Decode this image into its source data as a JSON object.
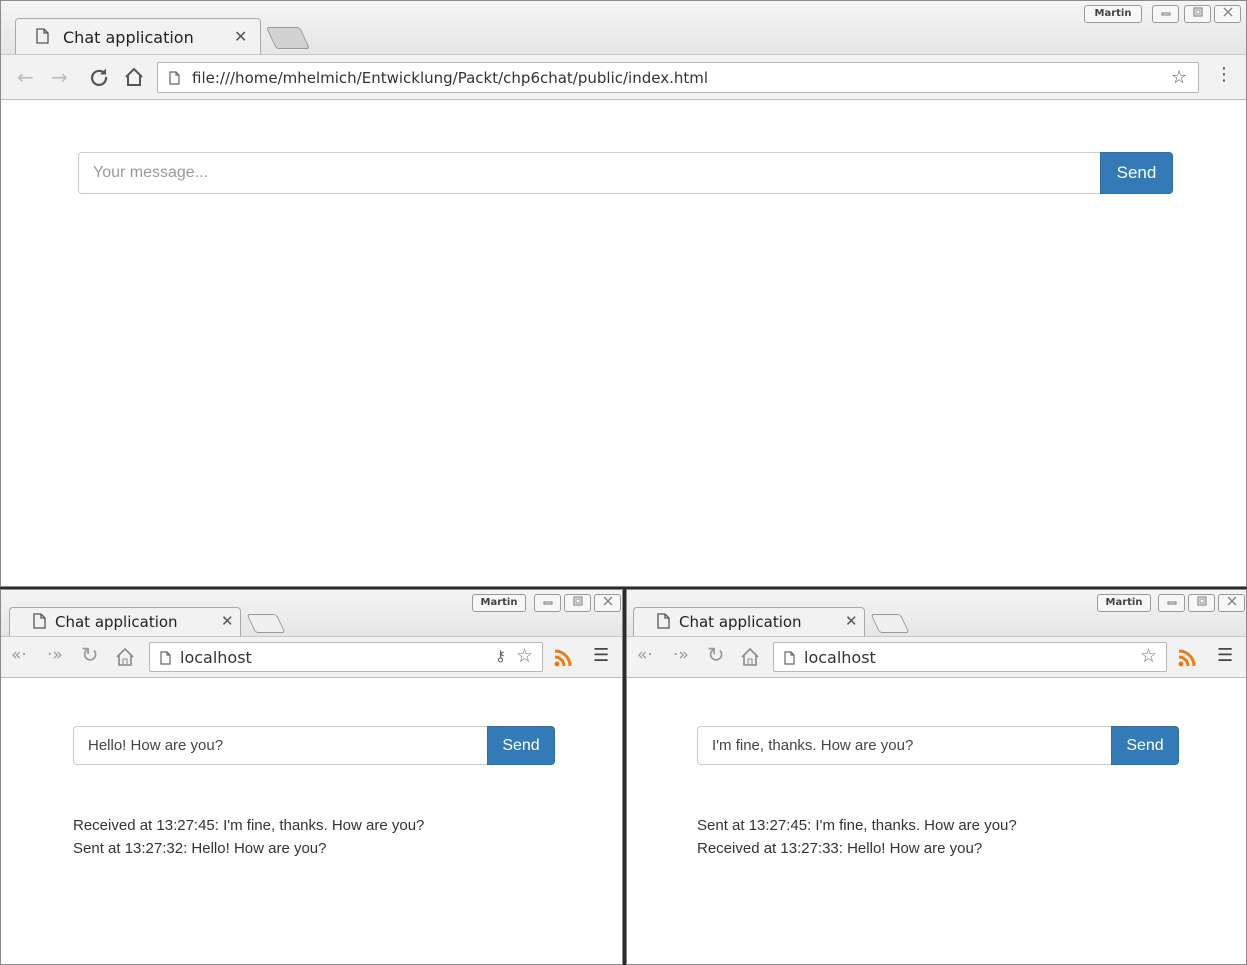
{
  "colors": {
    "primary": "#337ab7",
    "rss": "#f07b16"
  },
  "main_window": {
    "tab_title": "Chat application",
    "url": "file:///home/mhelmich/Entwicklung/Packt/chp6chat/public/index.html",
    "user_badge": "Martin",
    "input_placeholder": "Your message...",
    "input_value": "",
    "send_label": "Send"
  },
  "left_window": {
    "tab_title": "Chat application",
    "url": "localhost",
    "user_badge": "Martin",
    "input_value": "Hello! How are you?",
    "send_label": "Send",
    "messages": [
      "Received at 13:27:45: I'm fine, thanks. How are you?",
      "Sent at 13:27:32: Hello! How are you?"
    ]
  },
  "right_window": {
    "tab_title": "Chat application",
    "url": "localhost",
    "user_badge": "Martin",
    "input_value": "I'm fine, thanks. How are you?",
    "send_label": "Send",
    "messages": [
      "Sent at 13:27:45: I'm fine, thanks. How are you?",
      "Received at 13:27:33: Hello! How are you?"
    ]
  }
}
